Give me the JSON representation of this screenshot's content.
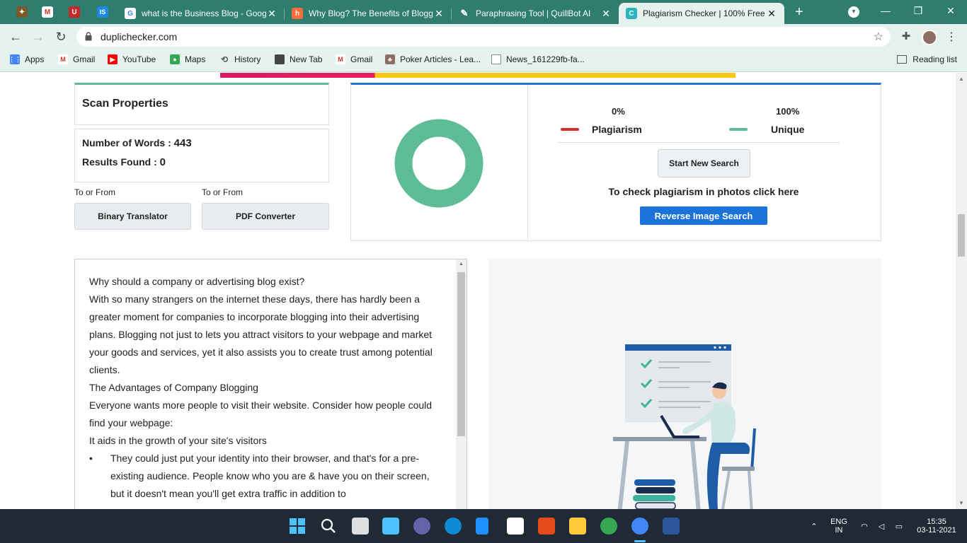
{
  "browser": {
    "tabs": [
      {
        "title": "what is the Business Blog - Goog"
      },
      {
        "title": "Why Blog? The Benefits of Blogg"
      },
      {
        "title": "Paraphrasing Tool | QuillBot AI"
      },
      {
        "title": "Plagiarism Checker | 100% Free"
      }
    ],
    "mini_tab_label": "IS",
    "url": "duplichecker.com",
    "bookmarks": [
      {
        "label": "Apps"
      },
      {
        "label": "Gmail"
      },
      {
        "label": "YouTube"
      },
      {
        "label": "Maps"
      },
      {
        "label": "History"
      },
      {
        "label": "New Tab"
      },
      {
        "label": "Gmail"
      },
      {
        "label": "Poker Articles - Lea..."
      },
      {
        "label": "News_161229fb-fa..."
      }
    ],
    "reading_list": "Reading list"
  },
  "scan": {
    "title": "Scan Properties",
    "words_label": "Number of Words :",
    "words_value": "443",
    "results_label": "Results Found :",
    "results_value": "0",
    "to_from_1": "To or From",
    "to_from_2": "To or From",
    "btn_binary": "Binary Translator",
    "btn_pdf": "PDF Converter"
  },
  "result": {
    "plagiarism_pct": "0%",
    "plagiarism_label": "Plagiarism",
    "unique_pct": "100%",
    "unique_label": "Unique",
    "start_button": "Start New Search",
    "photo_note": "To check plagiarism in photos click here",
    "reverse_button": "Reverse Image Search",
    "unique_fraction": 1.0,
    "colors": {
      "plagiarism": "#d32f2f",
      "unique": "#5ebd96"
    }
  },
  "text_lines": [
    "Why should a company or advertising blog exist?",
    "With so many strangers on the internet these days, there has hardly been a greater moment for companies to incorporate blogging into their advertising plans. Blogging not just to lets you attract visitors to your webpage and market your goods and services, yet it also assists you to create trust among potential clients.",
    "The Advantages of Company Blogging",
    "Everyone wants more people to visit their website. Consider how people could find your webpage:",
    "It aids in the growth of your site's visitors"
  ],
  "bullet": {
    "mark": "•",
    "text": "They could just put your identity into their browser, and that's for a pre-existing audience. People know who you are & have you on their screen, but it doesn't mean you'll get extra traffic in addition to"
  },
  "taskbar": {
    "lang_1": "ENG",
    "lang_2": "IN",
    "time": "15:35",
    "date": "03-11-2021"
  }
}
